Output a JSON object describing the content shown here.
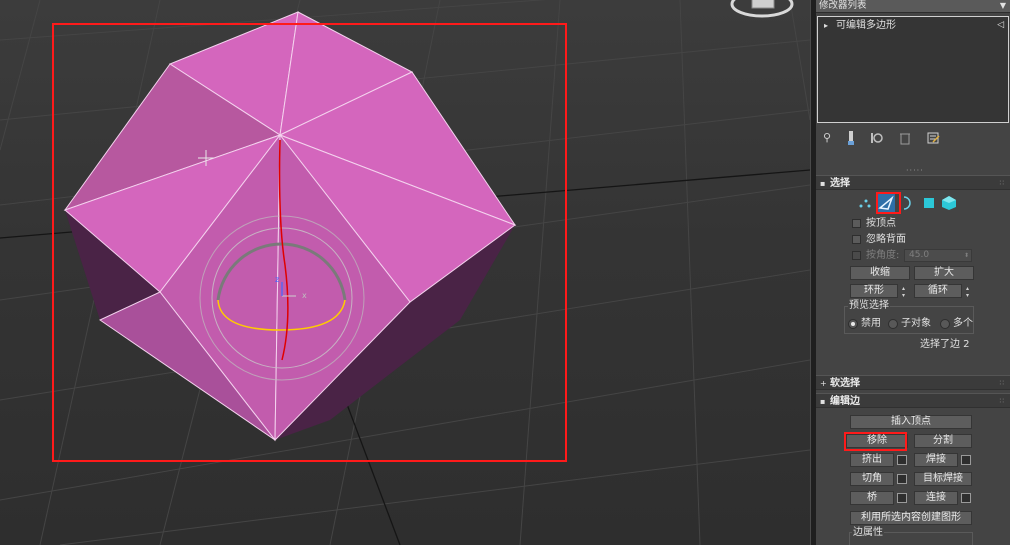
{
  "modifier_list": {
    "label": "修改器列表",
    "arrow": "▼"
  },
  "stack": {
    "item_label": "可编辑多边形",
    "expand_glyph": "▸",
    "bulb_glyph": "◁"
  },
  "selection": {
    "header": "选择",
    "by_vertex": "按顶点",
    "ignore_backfacing": "忽略背面",
    "by_angle": "按角度:",
    "angle_value": "45.0",
    "shrink": "收缩",
    "grow": "扩大",
    "ring": "环形",
    "loop": "循环",
    "preview_title": "预览选择",
    "preview_disabled": "禁用",
    "preview_subobject": "子对象",
    "preview_multi": "多个",
    "status": "选择了边 2"
  },
  "soft_selection": {
    "header": "软选择"
  },
  "edit_edges": {
    "header": "编辑边",
    "insert_vertex": "插入顶点",
    "remove": "移除",
    "split": "分割",
    "extrude": "挤出",
    "weld": "焊接",
    "chamfer": "切角",
    "target_weld": "目标焊接",
    "bridge": "桥",
    "connect": "连接",
    "create_shape": "利用所选内容创建图形",
    "edge_properties": "边属性"
  },
  "icons": {
    "pin": "pin-icon",
    "show_end_result": "show-end-result-icon",
    "make_unique": "make-unique-icon",
    "remove_modifier": "remove-modifier-icon",
    "configure": "configure-modifier-sets-icon",
    "vertex_mode": "vertex-mode-icon",
    "edge_mode": "edge-mode-icon",
    "border_mode": "border-mode-icon",
    "polygon_mode": "polygon-mode-icon",
    "element_mode": "element-mode-icon"
  },
  "colors": {
    "mesh_face_light": "#d466bd",
    "mesh_face_dark": "#a9509a",
    "highlight_red": "#ff1a1a",
    "viewcube_gray": "#d9d9d9",
    "panel_bg": "#444444"
  }
}
